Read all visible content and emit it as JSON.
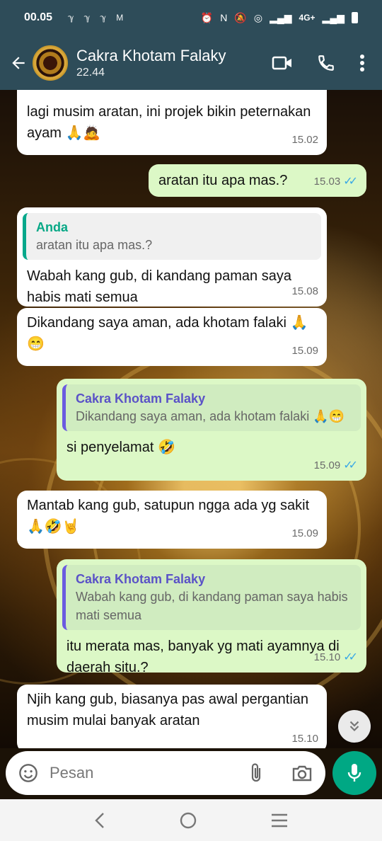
{
  "status_bar": {
    "time": "00.05",
    "left_icons": [
      "ℽ",
      "ℽ",
      "ℽ",
      "M"
    ],
    "network": "4G+"
  },
  "header": {
    "name": "Cakra Khotam Falaky",
    "subtitle": "22.44"
  },
  "messages": [
    {
      "dir": "in",
      "text": " lagi musim aratan, ini projek bikin peternakan ayam 🙏🙇",
      "time": "15.02"
    },
    {
      "dir": "out",
      "text": "aratan itu apa mas.?",
      "time": "15.03"
    },
    {
      "dir": "in",
      "quote_name": "Anda",
      "quote_text": "aratan itu apa mas.?",
      "text": "Wabah kang gub, di kandang paman saya habis mati semua",
      "time": "15.08"
    },
    {
      "dir": "in",
      "text": "Dikandang saya aman, ada khotam falaki 🙏😁",
      "time": "15.09"
    },
    {
      "dir": "out",
      "quote_name": "Cakra Khotam Falaky",
      "quote_text": "Dikandang saya aman, ada khotam falaki 🙏😁",
      "text": "si penyelamat 🤣",
      "time": "15.09"
    },
    {
      "dir": "in",
      "text": "Mantab kang gub, satupun ngga ada yg sakit 🙏🤣🤘",
      "time": "15.09"
    },
    {
      "dir": "out",
      "quote_name": "Cakra Khotam Falaky",
      "quote_text": "Wabah kang gub, di kandang paman saya habis mati semua",
      "text": "itu merata mas, banyak yg mati ayamnya di daerah situ.?",
      "time": "15.10"
    },
    {
      "dir": "in",
      "text": "Njih kang gub, biasanya pas awal pergantian musim  mulai banyak aratan",
      "time": "15.10"
    }
  ],
  "composer": {
    "placeholder": "Pesan"
  },
  "colors": {
    "header": "#2e4c59",
    "outgoing": "#dcf8c6",
    "incoming": "#ffffff",
    "accent": "#00a884"
  }
}
